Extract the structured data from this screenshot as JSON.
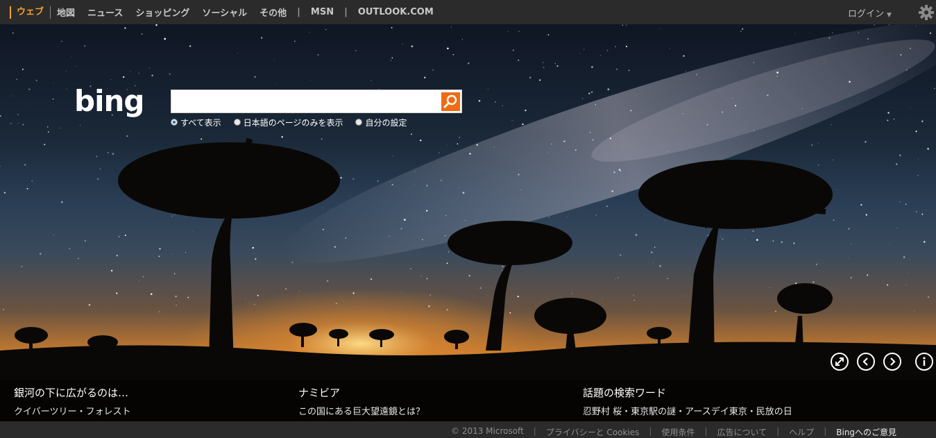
{
  "nav": {
    "items": [
      "ウェブ",
      "地図",
      "ニュース",
      "ショッピング",
      "ソーシャル",
      "その他"
    ],
    "separator": "|",
    "links": [
      "MSN",
      "OUTLOOK.COM"
    ]
  },
  "account": {
    "login_label": "ログイン"
  },
  "brand": {
    "logo_text": "bing"
  },
  "search": {
    "value": "",
    "placeholder": "",
    "scopes": [
      "すべて表示",
      "日本語のページのみを表示",
      "自分の設定"
    ]
  },
  "captions": [
    {
      "title": "銀河の下に広がるのは…",
      "subtitle": "クイバーツリー・フォレスト"
    },
    {
      "title": "ナミビア",
      "subtitle": "この国にある巨大望遠鏡とは？"
    },
    {
      "title": "話題の検索ワード",
      "subtitle": "忍野村 桜・東京駅の謎・アースデイ東京・民放の日"
    }
  ],
  "footer": {
    "copyright": "© 2013 Microsoft",
    "links": [
      "プライバシーと Cookies",
      "使用条件",
      "広告について",
      "ヘルプ"
    ],
    "feedback": "Bingへのご意見"
  },
  "colors": {
    "accent": "#f7a12b",
    "search_button": "#f06b13",
    "topbar": "#2b2b2b"
  }
}
